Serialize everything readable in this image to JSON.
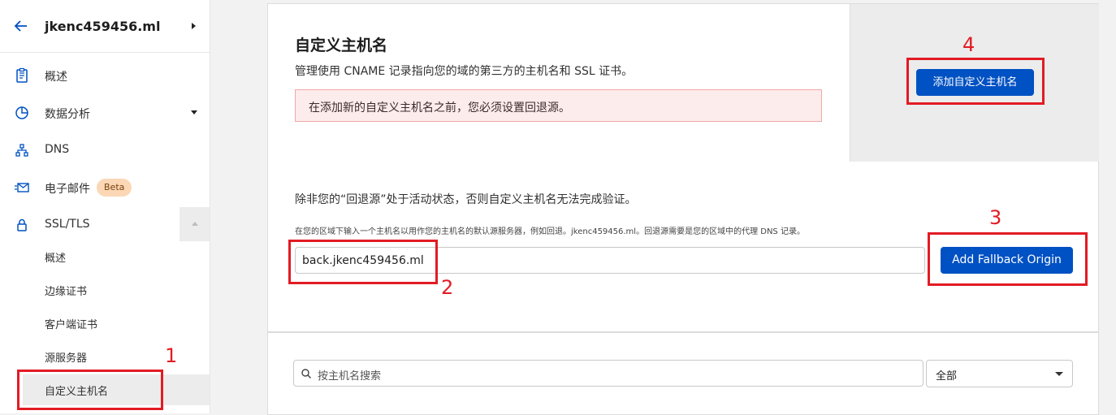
{
  "sidebar": {
    "zone_name": "jkenc459456.ml",
    "items": [
      {
        "label": "概述",
        "icon": "document-icon"
      },
      {
        "label": "数据分析",
        "icon": "pie-chart-icon"
      },
      {
        "label": "DNS",
        "icon": "network-icon"
      },
      {
        "label": "电子邮件",
        "icon": "envelope-icon",
        "badge": "Beta"
      },
      {
        "label": "SSL/TLS",
        "icon": "lock-icon"
      }
    ],
    "ssl_subitems": [
      "概述",
      "边缘证书",
      "客户端证书",
      "源服务器",
      "自定义主机名"
    ]
  },
  "custom_hostnames": {
    "title": "自定义主机名",
    "description": "管理使用 CNAME 记录指向您的域的第三方的主机名和 SSL 证书。",
    "warning": "在添加新的自定义主机名之前，您必须设置回退源。",
    "add_button": "添加自定义主机名"
  },
  "fallback": {
    "title": "除非您的“回退源”处于活动状态，否则自定义主机名无法完成验证。",
    "hint": "在您的区域下输入一个主机名以用作您的主机名的默认源服务器，例如回退。jkenc459456.ml。回退源需要是您的区域中的代理 DNS 记录。",
    "input_value": "back.jkenc459456.ml",
    "button": "Add Fallback Origin"
  },
  "list": {
    "search_placeholder": "按主机名搜索",
    "filter_value": "全部"
  },
  "annotations": [
    "1",
    "2",
    "3",
    "4"
  ],
  "colors": {
    "accent": "#0051c3",
    "annotation": "#e21b24",
    "warning_bg": "#fdecec"
  }
}
